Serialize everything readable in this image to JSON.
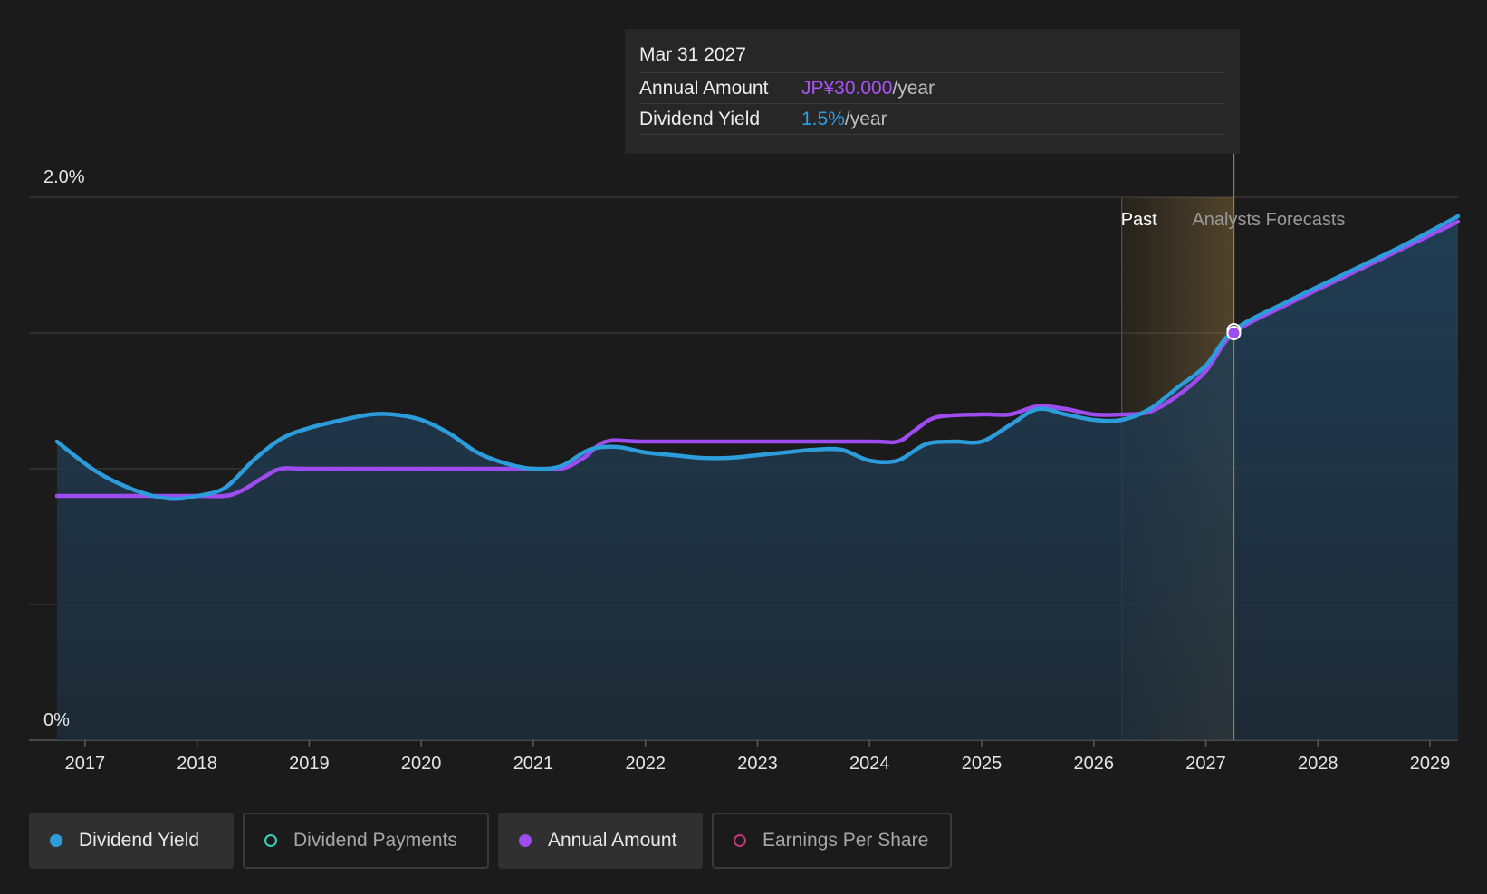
{
  "colors": {
    "background": "#1b1b1b",
    "dividend_yield": "#2d9cdb",
    "annual_amount": "#9e4cf0",
    "dividend_payments": "#3ad2b4",
    "earnings_per_share": "#c0357d",
    "forecast_band": "#c49a4a",
    "grid": "#333333"
  },
  "tooltip": {
    "date": "Mar 31 2027",
    "rows": [
      {
        "label": "Annual Amount",
        "value": "JP¥30.000",
        "unit": "/year",
        "color": "#a952f5"
      },
      {
        "label": "Dividend Yield",
        "value": "1.5%",
        "unit": "/year",
        "color": "#2f9de6"
      }
    ]
  },
  "legend": [
    {
      "label": "Dividend Yield",
      "active": true,
      "icon": "filled-circle",
      "color": "#2d9cdb"
    },
    {
      "label": "Dividend Payments",
      "active": false,
      "icon": "hollow-circle",
      "color": "#3ad2b4"
    },
    {
      "label": "Annual Amount",
      "active": true,
      "icon": "filled-circle",
      "color": "#9e4cf0"
    },
    {
      "label": "Earnings Per Share",
      "active": false,
      "icon": "hollow-circle",
      "color": "#c0357d"
    }
  ],
  "chart_data": {
    "type": "line",
    "ylim": [
      0,
      2.0
    ],
    "y_tick_labels": [
      {
        "value": 2.0,
        "label": "2.0%"
      },
      {
        "value": 0,
        "label": "0%"
      }
    ],
    "y_gridlines": [
      0,
      0.5,
      1.0,
      1.5,
      2.0
    ],
    "xlim": [
      2016.5,
      2029.25
    ],
    "x_ticks": [
      2017,
      2018,
      2019,
      2020,
      2021,
      2022,
      2023,
      2024,
      2025,
      2026,
      2027,
      2028,
      2029
    ],
    "x_tick_labels": [
      "2017",
      "2018",
      "2019",
      "2020",
      "2021",
      "2022",
      "2023",
      "2024",
      "2025",
      "2026",
      "2027",
      "2028",
      "2029"
    ],
    "annotations": {
      "past_label": "Past",
      "forecast_label": "Analysts Forecasts",
      "past_start": 2026.25,
      "forecast_start": 2027.25,
      "tooltip_x": 2027.25
    },
    "series": [
      {
        "name": "Dividend Yield",
        "color": "#2d9cdb",
        "filled": true,
        "points": [
          [
            2016.75,
            1.1
          ],
          [
            2017.1,
            0.99
          ],
          [
            2017.45,
            0.92
          ],
          [
            2017.75,
            0.89
          ],
          [
            2018.0,
            0.9
          ],
          [
            2018.25,
            0.93
          ],
          [
            2018.5,
            1.03
          ],
          [
            2018.75,
            1.11
          ],
          [
            2019.0,
            1.15
          ],
          [
            2019.3,
            1.18
          ],
          [
            2019.55,
            1.2
          ],
          [
            2019.75,
            1.2
          ],
          [
            2020.0,
            1.18
          ],
          [
            2020.25,
            1.13
          ],
          [
            2020.5,
            1.06
          ],
          [
            2020.75,
            1.02
          ],
          [
            2021.0,
            1.0
          ],
          [
            2021.25,
            1.01
          ],
          [
            2021.5,
            1.07
          ],
          [
            2021.75,
            1.08
          ],
          [
            2022.0,
            1.06
          ],
          [
            2022.25,
            1.05
          ],
          [
            2022.5,
            1.04
          ],
          [
            2022.75,
            1.04
          ],
          [
            2023.0,
            1.05
          ],
          [
            2023.25,
            1.06
          ],
          [
            2023.5,
            1.07
          ],
          [
            2023.75,
            1.07
          ],
          [
            2024.0,
            1.03
          ],
          [
            2024.25,
            1.03
          ],
          [
            2024.5,
            1.09
          ],
          [
            2024.75,
            1.1
          ],
          [
            2025.0,
            1.1
          ],
          [
            2025.25,
            1.16
          ],
          [
            2025.5,
            1.22
          ],
          [
            2025.75,
            1.2
          ],
          [
            2026.0,
            1.18
          ],
          [
            2026.25,
            1.18
          ],
          [
            2026.5,
            1.22
          ],
          [
            2026.75,
            1.3
          ],
          [
            2027.0,
            1.38
          ],
          [
            2027.25,
            1.51
          ],
          [
            2027.75,
            1.62
          ],
          [
            2028.25,
            1.72
          ],
          [
            2028.75,
            1.82
          ],
          [
            2029.25,
            1.93
          ]
        ]
      },
      {
        "name": "Annual Amount",
        "color": "#9e4cf0",
        "filled": false,
        "points": [
          [
            2016.75,
            0.9
          ],
          [
            2017.0,
            0.9
          ],
          [
            2017.5,
            0.9
          ],
          [
            2018.0,
            0.9
          ],
          [
            2018.25,
            0.9
          ],
          [
            2018.4,
            0.92
          ],
          [
            2018.6,
            0.97
          ],
          [
            2018.75,
            1.0
          ],
          [
            2019.0,
            1.0
          ],
          [
            2020.0,
            1.0
          ],
          [
            2021.0,
            1.0
          ],
          [
            2021.25,
            1.0
          ],
          [
            2021.45,
            1.04
          ],
          [
            2021.65,
            1.1
          ],
          [
            2022.0,
            1.1
          ],
          [
            2023.0,
            1.1
          ],
          [
            2024.0,
            1.1
          ],
          [
            2024.25,
            1.1
          ],
          [
            2024.4,
            1.14
          ],
          [
            2024.6,
            1.19
          ],
          [
            2025.0,
            1.2
          ],
          [
            2025.25,
            1.2
          ],
          [
            2025.5,
            1.23
          ],
          [
            2025.75,
            1.22
          ],
          [
            2026.0,
            1.2
          ],
          [
            2026.25,
            1.2
          ],
          [
            2026.5,
            1.21
          ],
          [
            2026.75,
            1.27
          ],
          [
            2027.0,
            1.36
          ],
          [
            2027.25,
            1.5
          ],
          [
            2027.75,
            1.61
          ],
          [
            2028.25,
            1.71
          ],
          [
            2028.75,
            1.81
          ],
          [
            2029.25,
            1.91
          ]
        ]
      }
    ]
  }
}
